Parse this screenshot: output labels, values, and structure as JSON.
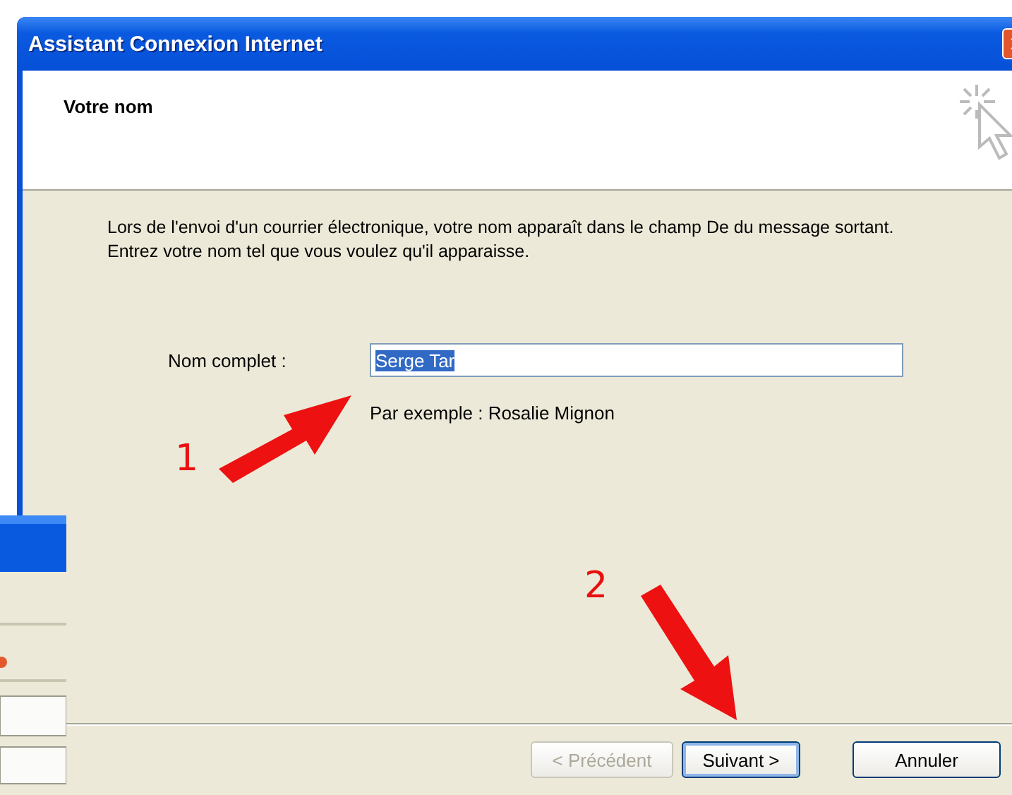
{
  "window": {
    "title": "Assistant Connexion Internet"
  },
  "header": {
    "title": "Votre nom"
  },
  "description": "Lors de l'envoi d'un courrier électronique, votre nom apparaît dans le champ De du message sortant. Entrez votre nom tel que vous voulez qu'il apparaisse.",
  "name_field": {
    "label": "Nom complet :",
    "value": "Serge Tar",
    "selected": true
  },
  "hint": "Par exemple : Rosalie Mignon",
  "buttons": [
    {
      "label": "< Précédent",
      "disabled": true,
      "default": false
    },
    {
      "label": "Suivant >",
      "disabled": false,
      "default": true
    },
    {
      "label": "Annuler",
      "disabled": false,
      "default": false
    }
  ],
  "annotations": [
    {
      "label": "1",
      "kind": "up-right"
    },
    {
      "label": "2",
      "kind": "down"
    }
  ]
}
